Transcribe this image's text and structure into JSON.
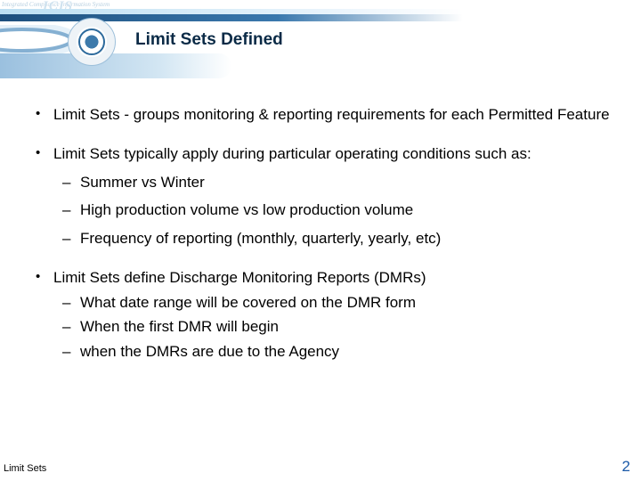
{
  "header": {
    "icis_tag": "Integrated Compliance Information System",
    "icis_logo_text": "ICIS",
    "title": "Limit Sets Defined",
    "seal_name": "EPA seal"
  },
  "bullets": [
    {
      "text": "Limit Sets - groups monitoring & reporting requirements for each Permitted Feature",
      "sub": []
    },
    {
      "text": "Limit Sets typically apply during particular operating conditions such as:",
      "sub": [
        "Summer vs Winter",
        "High production volume vs low production volume",
        "Frequency of reporting (monthly, quarterly, yearly, etc)"
      ],
      "spaced": true
    },
    {
      "text": "Limit Sets define Discharge Monitoring Reports (DMRs)",
      "sub": [
        "What date range will be covered on the DMR form",
        "When the first DMR will begin",
        "when the DMRs are due to the Agency"
      ]
    }
  ],
  "footer": {
    "left": "Limit Sets",
    "page_number": "2"
  }
}
